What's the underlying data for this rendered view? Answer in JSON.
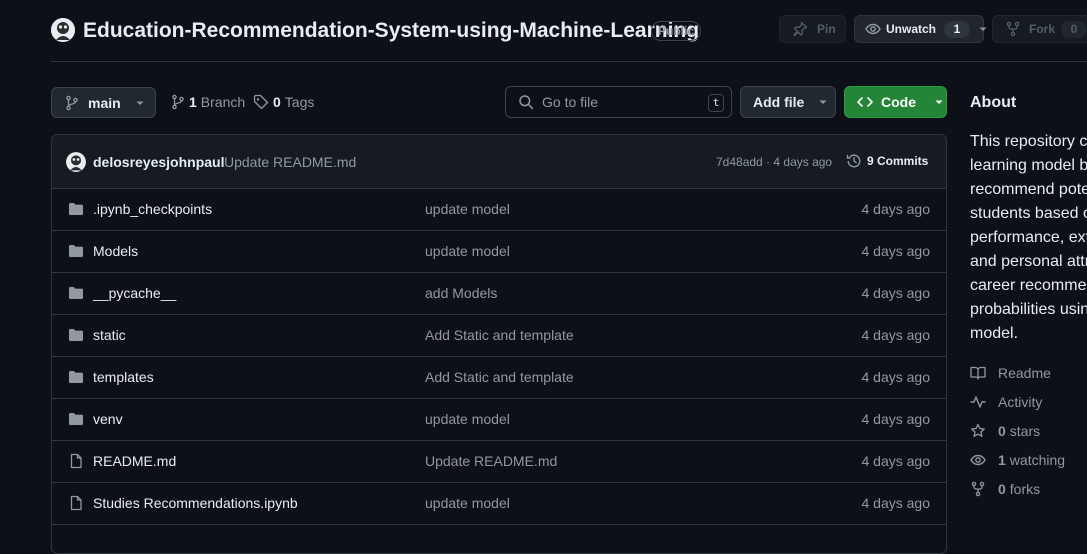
{
  "repo": {
    "name": "Education-Recommendation-System-using-Machine-Learning",
    "visibility": "Public"
  },
  "actions": {
    "pin_label": "Pin",
    "unwatch_label": "Unwatch",
    "watch_count": "1",
    "fork_label": "Fork",
    "fork_count": "0"
  },
  "toolbar": {
    "branch_name": "main",
    "branch_count": "1",
    "branch_label": "Branch",
    "tag_count": "0",
    "tag_label": "Tags",
    "search_placeholder": "Go to file",
    "search_shortcut": "t",
    "add_file_label": "Add file",
    "code_label": "Code"
  },
  "latest_commit": {
    "author": "delosreyesjohnpaul",
    "message": "Update README.md",
    "hash_time": "7d48add · 4 days ago",
    "commits_count": "9 Commits"
  },
  "files": [
    {
      "name": ".ipynb_checkpoints",
      "type": "folder",
      "message": "update model",
      "time": "4 days ago"
    },
    {
      "name": "Models",
      "type": "folder",
      "message": "update model",
      "time": "4 days ago"
    },
    {
      "name": "__pycache__",
      "type": "folder",
      "message": "add Models",
      "time": "4 days ago"
    },
    {
      "name": "static",
      "type": "folder",
      "message": "Add Static and template",
      "time": "4 days ago"
    },
    {
      "name": "templates",
      "type": "folder",
      "message": "Add Static and template",
      "time": "4 days ago"
    },
    {
      "name": "venv",
      "type": "folder",
      "message": "update model",
      "time": "4 days ago"
    },
    {
      "name": "README.md",
      "type": "file",
      "message": "Update README.md",
      "time": "4 days ago"
    },
    {
      "name": "Studies Recommendations.ipynb",
      "type": "file",
      "message": "update model",
      "time": "4 days ago"
    }
  ],
  "about": {
    "title": "About",
    "description_lines": [
      "This repository c",
      "learning model b",
      "recommend pote",
      "students based o",
      "performance, ext",
      "and personal attr",
      "career recommen",
      "probabilities usin",
      "model."
    ],
    "readme_label": "Readme",
    "activity_label": "Activity",
    "stars_count": "0",
    "stars_label": "stars",
    "watching_count": "1",
    "watching_label": "watching",
    "forks_count": "0",
    "forks_label": "forks"
  },
  "colors": {
    "background": "#0d1117",
    "border": "#30363d",
    "code_button": "#238636",
    "muted_text": "#9198a1",
    "folder_icon": "#9198a1"
  }
}
